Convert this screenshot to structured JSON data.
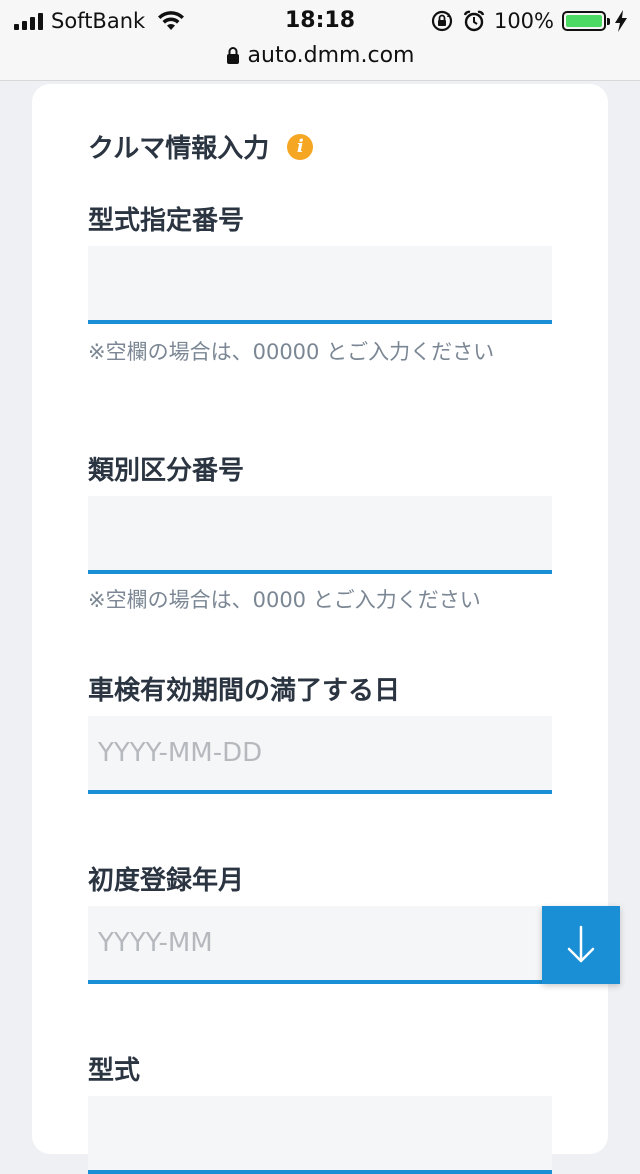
{
  "status_bar": {
    "carrier": "SoftBank",
    "time": "18:18",
    "battery_percent": "100%",
    "url": "auto.dmm.com"
  },
  "form": {
    "section_title": "クルマ情報入力",
    "fields": [
      {
        "label": "型式指定番号",
        "value": "",
        "placeholder": "",
        "hint": "※空欄の場合は、00000 とご入力ください"
      },
      {
        "label": "類別区分番号",
        "value": "",
        "placeholder": "",
        "hint": "※空欄の場合は、0000 とご入力ください"
      },
      {
        "label": "車検有効期間の満了する日",
        "value": "",
        "placeholder": "YYYY-MM-DD"
      },
      {
        "label": "初度登録年月",
        "value": "",
        "placeholder": "YYYY-MM"
      },
      {
        "label": "型式",
        "value": "",
        "placeholder": ""
      }
    ]
  },
  "colors": {
    "accent": "#1a8fd6",
    "info_icon": "#f5a623",
    "battery": "#4cd964"
  },
  "icons": {
    "info": "info-icon",
    "scroll": "arrow-down-icon"
  }
}
